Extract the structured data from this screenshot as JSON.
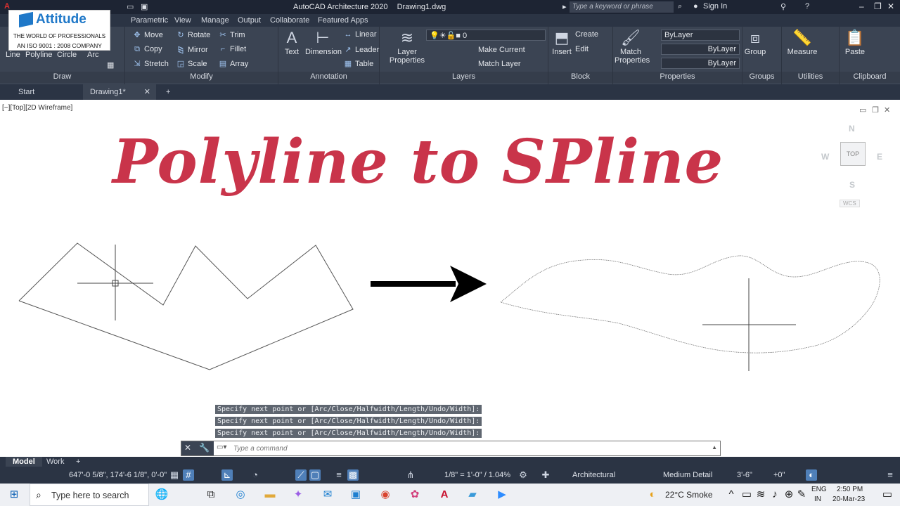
{
  "app": {
    "title": "AutoCAD Architecture 2020",
    "filename": "Drawing1.dwg"
  },
  "search": {
    "placeholder": "Type a keyword or phrase"
  },
  "account": {
    "sign_in": "Sign In"
  },
  "logo": {
    "brand": "Attitude",
    "line1": "THE WORLD OF PROFESSIONALS",
    "line2": "AN ISO 9001 : 2008 COMPANY"
  },
  "menu_tabs": [
    "ate",
    "Parametric",
    "View",
    "Manage",
    "Output",
    "Collaborate",
    "Featured Apps"
  ],
  "ribbon": {
    "draw": {
      "line": "Line",
      "polyline": "Polyline",
      "circle": "Circle",
      "arc": "Arc",
      "label": "Draw"
    },
    "modify": {
      "move": "Move",
      "rotate": "Rotate",
      "trim": "Trim",
      "copy": "Copy",
      "mirror": "Mirror",
      "fillet": "Fillet",
      "stretch": "Stretch",
      "scale": "Scale",
      "array": "Array",
      "label": "Modify"
    },
    "annotation": {
      "text": "Text",
      "dimension": "Dimension",
      "linear": "Linear",
      "leader": "Leader",
      "table": "Table",
      "label": "Annotation"
    },
    "layers": {
      "properties": "Layer Properties",
      "layer_value": "0",
      "make_current": "Make Current",
      "match_layer": "Match Layer",
      "label": "Layers"
    },
    "block": {
      "insert": "Insert",
      "create": "Create",
      "edit": "Edit",
      "label": "Block"
    },
    "properties": {
      "match": "Match Properties",
      "color": "ByLayer",
      "linetype": "ByLayer",
      "lineweight": "ByLayer",
      "label": "Properties"
    },
    "groups": {
      "group": "Group",
      "label": "Groups"
    },
    "utilities": {
      "measure": "Measure",
      "label": "Utilities"
    },
    "clipboard": {
      "paste": "Paste",
      "label": "Clipboard"
    }
  },
  "doc_tabs": {
    "start": "Start",
    "drawing": "Drawing1*"
  },
  "viewport": {
    "label": "[−][Top][2D Wireframe]"
  },
  "title_text": "Polyline to SPline",
  "viewcube": {
    "n": "N",
    "s": "S",
    "e": "E",
    "w": "W",
    "top": "TOP",
    "wcs": "WCS"
  },
  "command_history": [
    "Specify next point or [Arc/Close/Halfwidth/Length/Undo/Width]:",
    "Specify next point or [Arc/Close/Halfwidth/Length/Undo/Width]:",
    "Specify next point or [Arc/Close/Halfwidth/Length/Undo/Width]:"
  ],
  "command": {
    "placeholder": "Type a command"
  },
  "layout_tabs": {
    "model": "Model",
    "work": "Work"
  },
  "status": {
    "coords": "647'-0 5/8\", 174'-6 1/8\", 0'-0\"",
    "scale": "1/8\" = 1'-0\" / 1.04%",
    "units": "Architectural",
    "detail": "Medium Detail",
    "elevation": "3'-6\"",
    "offset": "+0\""
  },
  "taskbar": {
    "search_placeholder": "Type here to search",
    "weather": "22°C  Smoke",
    "lang1": "ENG",
    "lang2": "IN",
    "time": "2:50 PM",
    "date": "20-Mar-23"
  },
  "colors": {
    "title_red": "#c9344a",
    "ribbon_bg": "#3b4453",
    "accent_blue": "#1f78c8"
  }
}
